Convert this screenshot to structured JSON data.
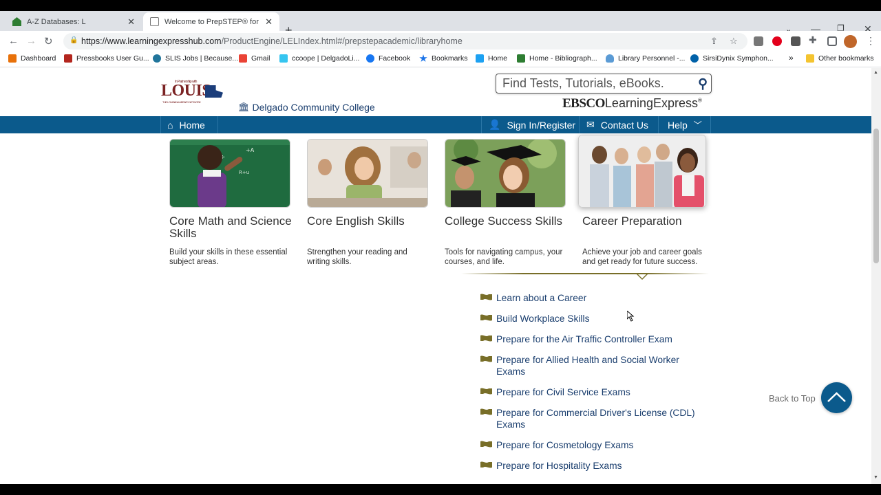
{
  "browser": {
    "tabs": [
      {
        "title": "A-Z Databases: L",
        "active": false
      },
      {
        "title": "Welcome to PrepSTEP® for Colle",
        "active": true
      }
    ],
    "url_host": "https://www.learningexpresshub.com",
    "url_path": "/ProductEngine/LELIndex.html#/prepstepacademic/libraryhome",
    "bookmarks": [
      {
        "label": "Dashboard",
        "icon_color": "#e8710a"
      },
      {
        "label": "Pressbooks User Gu...",
        "icon_color": "#b3261e"
      },
      {
        "label": "SLIS Jobs | Because...",
        "icon_color": "#21759b"
      },
      {
        "label": "Gmail",
        "icon_color": "#ea4335"
      },
      {
        "label": "ccoope | DelgadoLi...",
        "icon_color": "#36c5f0"
      },
      {
        "label": "Facebook",
        "icon_color": "#1877f2"
      },
      {
        "label": "Bookmarks",
        "icon_color": "#1a73e8"
      },
      {
        "label": "Home",
        "icon_color": "#1da1f2"
      },
      {
        "label": "Home - Bibliograph...",
        "icon_color": "#2e7d32"
      },
      {
        "label": "Library Personnel -...",
        "icon_color": "#5b9bd5"
      },
      {
        "label": "SirsiDynix Symphon...",
        "icon_color": "#0061a8"
      }
    ],
    "bookmarks_overflow": "»",
    "other_bookmarks": "Other bookmarks"
  },
  "header": {
    "louis_top": "In Partnership with",
    "louis_logo": "LOUIS",
    "louis_sub": "THE LOUISIANA LIBRARY NETWORK",
    "college": "Delgado Community College",
    "search_placeholder": "Find Tests, Tutorials, eBooks.",
    "ebsco": "EBSCO",
    "learning_express": "LearningExpress",
    "reg": "®"
  },
  "nav": {
    "home": "Home",
    "sign_in": "Sign In/Register",
    "contact": "Contact Us",
    "help": "Help"
  },
  "cards": [
    {
      "title": "Core Math and Science Skills",
      "desc": "Build your skills in these essential subject areas."
    },
    {
      "title": "Core English Skills",
      "desc": "Strengthen your reading and writing skills."
    },
    {
      "title": "College Success Skills",
      "desc": "Tools for navigating campus, your courses, and life."
    },
    {
      "title": "Career Preparation",
      "desc": "Achieve your job and career goals and get ready for future success."
    }
  ],
  "career_links": [
    "Learn about a Career",
    "Build Workplace Skills",
    "Prepare for the Air Traffic Controller Exam",
    "Prepare for Allied Health and Social Worker Exams",
    "Prepare for Civil Service Exams",
    "Prepare for Commercial Driver's License (CDL) Exams",
    "Prepare for Cosmetology Exams",
    "Prepare for Hospitality Exams"
  ],
  "back_to_top": "Back to Top",
  "colors": {
    "nav_blue": "#0b5a8c",
    "link_blue": "#1a3e6e",
    "flag_olive": "#786e28",
    "louis_red": "#7b2324"
  }
}
